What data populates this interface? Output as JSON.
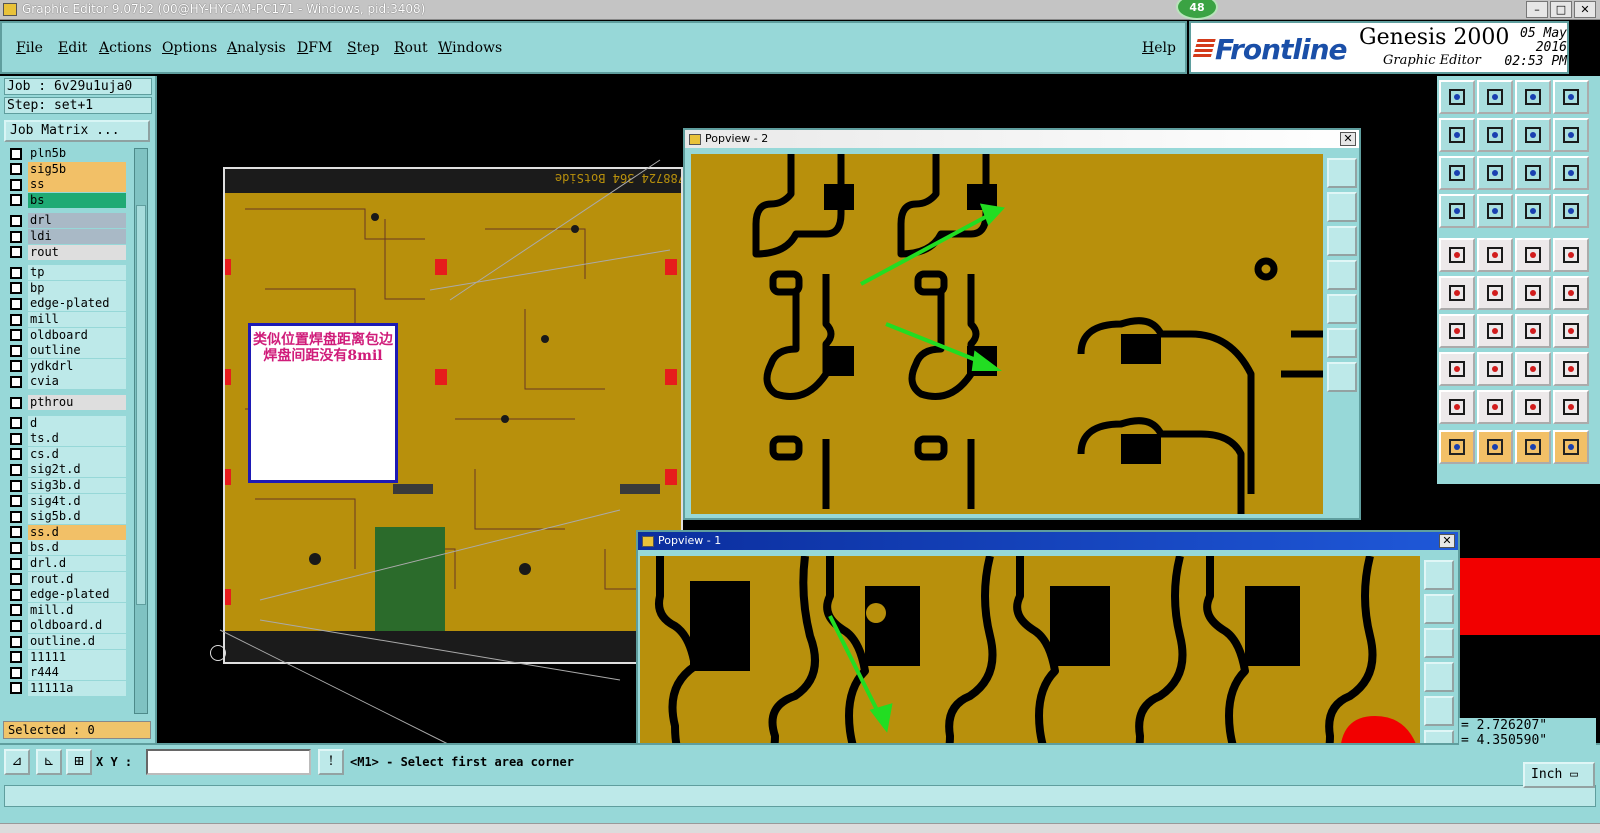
{
  "window": {
    "title": "Graphic Editor 9.07b2 (00@HY-HYCAM-PC171 - Windows, pid:3408)",
    "badge": "48",
    "minimize": "–",
    "maximize": "□",
    "close": "✕"
  },
  "menu": {
    "items": [
      "File",
      "Edit",
      "Actions",
      "Options",
      "Analysis",
      "DFM",
      "Step",
      "Rout",
      "Windows"
    ],
    "help": "Help"
  },
  "brand": {
    "logo": "Frontline",
    "product": "Genesis 2000",
    "subtitle": "Graphic Editor",
    "date": "05 May 2016",
    "time": "02:53 PM"
  },
  "left": {
    "job": "Job : 6v29u1uja0",
    "step": "Step: set+1",
    "job_matrix": "Job Matrix ...",
    "selected": "Selected : 0",
    "layers": [
      {
        "name": "pln5b",
        "color": "#97d8d8"
      },
      {
        "name": "sig5b",
        "color": "#f2c067"
      },
      {
        "name": "ss",
        "color": "#f2c067"
      },
      {
        "name": "bs",
        "color": "#1faa74"
      },
      {
        "name": "drl",
        "color": "#a9b9c6"
      },
      {
        "name": "ldi",
        "color": "#a9b9c6"
      },
      {
        "name": "rout",
        "color": "#dedede"
      },
      {
        "name": "tp",
        "color": "#bde9e9"
      },
      {
        "name": "bp",
        "color": "#bde9e9"
      },
      {
        "name": "edge-plated",
        "color": "#bde9e9"
      },
      {
        "name": "mill",
        "color": "#bde9e9"
      },
      {
        "name": "oldboard",
        "color": "#bde9e9"
      },
      {
        "name": "outline",
        "color": "#bde9e9"
      },
      {
        "name": "ydkdrl",
        "color": "#bde9e9"
      },
      {
        "name": "cvia",
        "color": "#bde9e9"
      },
      {
        "name": "pthrou",
        "color": "#dedede"
      },
      {
        "name": "d",
        "color": "#bde9e9"
      },
      {
        "name": "ts.d",
        "color": "#bde9e9"
      },
      {
        "name": "cs.d",
        "color": "#bde9e9"
      },
      {
        "name": "sig2t.d",
        "color": "#bde9e9"
      },
      {
        "name": "sig3b.d",
        "color": "#bde9e9"
      },
      {
        "name": "sig4t.d",
        "color": "#bde9e9"
      },
      {
        "name": "sig5b.d",
        "color": "#bde9e9"
      },
      {
        "name": "ss.d",
        "color": "#f2c067"
      },
      {
        "name": "bs.d",
        "color": "#bde9e9"
      },
      {
        "name": "drl.d",
        "color": "#bde9e9"
      },
      {
        "name": "rout.d",
        "color": "#bde9e9"
      },
      {
        "name": "edge-plated",
        "color": "#bde9e9"
      },
      {
        "name": "mill.d",
        "color": "#bde9e9"
      },
      {
        "name": "oldboard.d",
        "color": "#bde9e9"
      },
      {
        "name": "outline.d",
        "color": "#bde9e9"
      },
      {
        "name": "11111",
        "color": "#bde9e9"
      },
      {
        "name": "r444",
        "color": "#bde9e9"
      },
      {
        "name": "11111a",
        "color": "#bde9e9"
      }
    ]
  },
  "canvas": {
    "board_label": "788724 364 BotSide",
    "note": "类似位置焊盘距离包边焊盘间距没有8mil"
  },
  "popview2": {
    "title": "Popview - 2",
    "close": "✕"
  },
  "popview1": {
    "title": "Popview - 1",
    "close": "✕"
  },
  "bottom": {
    "xy_label": "X Y :",
    "xy_value": "",
    "prompt": "<M1> - Select first area corner",
    "coord_x": "= 2.726207\"",
    "coord_y": "= 4.350590\"",
    "units": "Inch"
  },
  "colors": {
    "board": "#b8900c",
    "ui": "#97d8d8",
    "arrow": "#22dd22"
  }
}
